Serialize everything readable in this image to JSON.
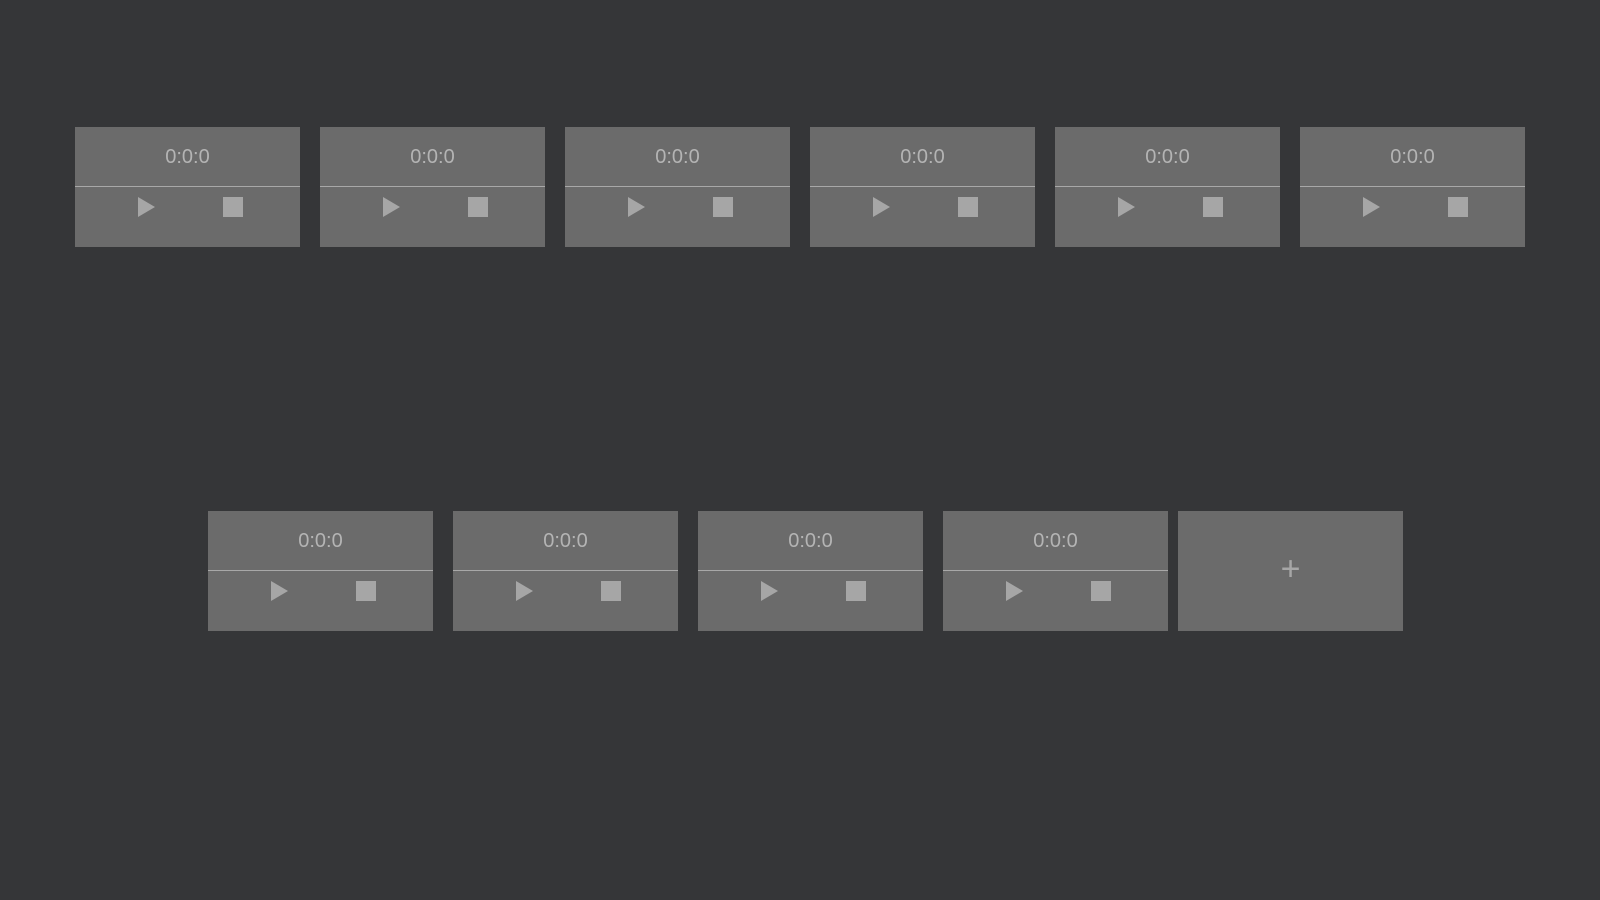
{
  "timers": [
    {
      "display": "0:0:0",
      "play_icon": "play-icon",
      "stop_icon": "stop-icon"
    },
    {
      "display": "0:0:0",
      "play_icon": "play-icon",
      "stop_icon": "stop-icon"
    },
    {
      "display": "0:0:0",
      "play_icon": "play-icon",
      "stop_icon": "stop-icon"
    },
    {
      "display": "0:0:0",
      "play_icon": "play-icon",
      "stop_icon": "stop-icon"
    },
    {
      "display": "0:0:0",
      "play_icon": "play-icon",
      "stop_icon": "stop-icon"
    },
    {
      "display": "0:0:0",
      "play_icon": "play-icon",
      "stop_icon": "stop-icon"
    },
    {
      "display": "0:0:0",
      "play_icon": "play-icon",
      "stop_icon": "stop-icon"
    },
    {
      "display": "0:0:0",
      "play_icon": "play-icon",
      "stop_icon": "stop-icon"
    },
    {
      "display": "0:0:0",
      "play_icon": "play-icon",
      "stop_icon": "stop-icon"
    },
    {
      "display": "0:0:0",
      "play_icon": "play-icon",
      "stop_icon": "stop-icon"
    }
  ],
  "add_button": {
    "label": "+",
    "icon": "plus-icon"
  },
  "colors": {
    "background": "#353638",
    "card": "#6b6b6b",
    "text": "#b4b4b4",
    "icon": "#a6a6a6"
  }
}
